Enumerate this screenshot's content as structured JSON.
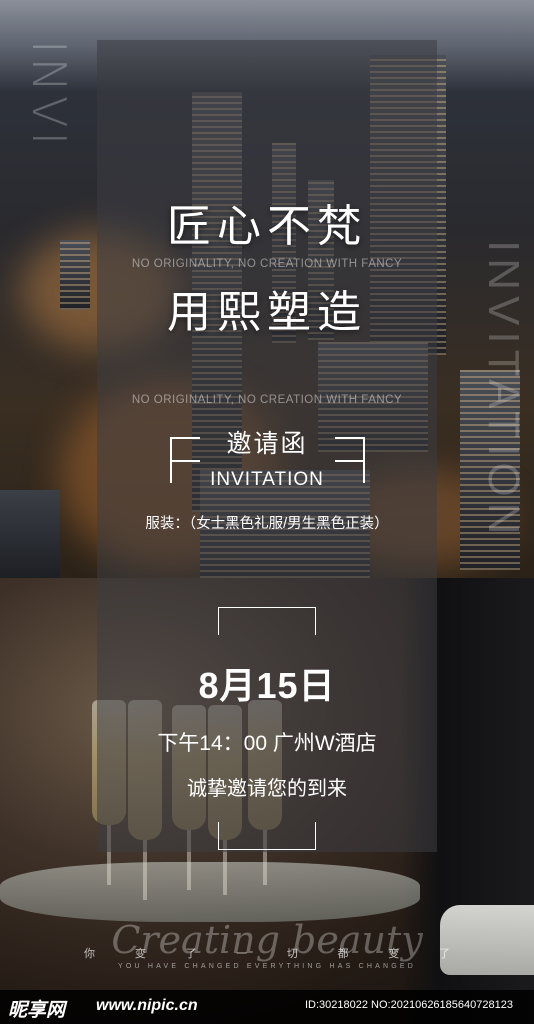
{
  "background": {
    "side_text_left": "INVI",
    "side_text_right": "INVITATION"
  },
  "headline": {
    "line1": "匠心不梵",
    "line2": "用熙塑造",
    "sub1": "NO ORIGINALITY, NO CREATION WITH FANCY",
    "sub2": "NO ORIGINALITY, NO CREATION WITH FANCY"
  },
  "invitation": {
    "title_cn": "邀请函",
    "title_en": "INVITATION",
    "dress_code": "服装：（女士黑色礼服/男生黑色正装）"
  },
  "event": {
    "date": "8月15日",
    "time_place": "下午14：00  广州W酒店",
    "welcome": "诚挚邀请您的到来"
  },
  "slogan": {
    "cn_chars": [
      "你",
      "变",
      "了",
      "一",
      "切",
      "都",
      "变",
      "了"
    ],
    "en": "YOU HAVE CHANGED EVERYTHING HAS CHANGED",
    "script": "Creating beauty"
  },
  "watermark": {
    "logo": "昵享网",
    "url": "www.nipic.cn",
    "id": "ID:30218022 NO:20210626185640728123"
  }
}
